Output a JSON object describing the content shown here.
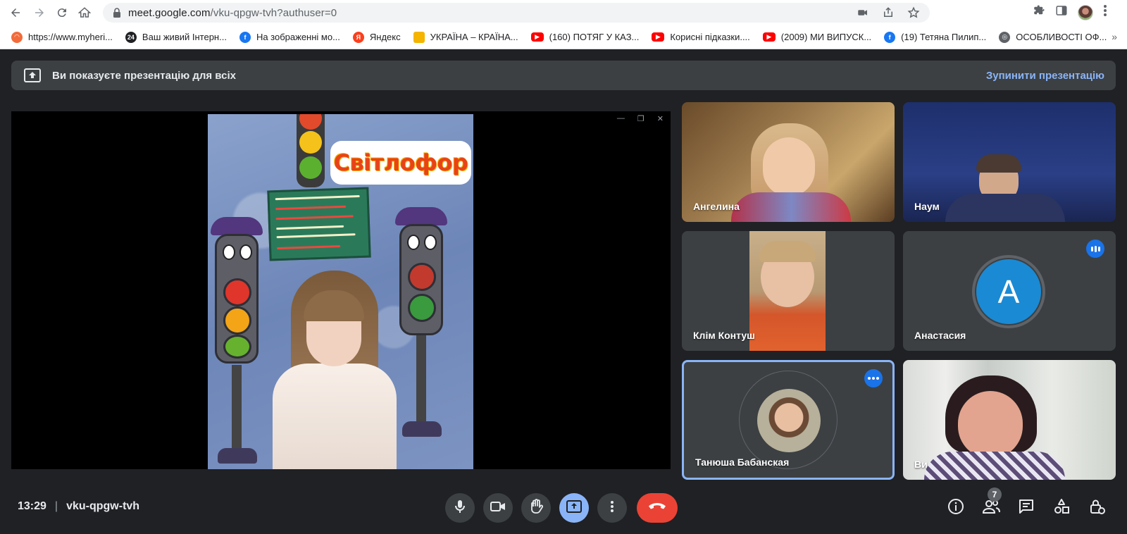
{
  "browser": {
    "url_host": "meet.google.com",
    "url_path": "/vku-qpgw-tvh?authuser=0",
    "bookmarks": [
      {
        "label": "https://www.myheri...",
        "color": "#f26b3a",
        "glyph": ""
      },
      {
        "label": "Ваш живий Інтерн...",
        "color": "#202124",
        "glyph": "24"
      },
      {
        "label": "На зображенні мо...",
        "color": "#1877f2",
        "glyph": "f"
      },
      {
        "label": "Яндекс",
        "color": "#fc3f1d",
        "glyph": "Я"
      },
      {
        "label": "УКРАЇНА – КРАЇНА...",
        "color": "#f4b400",
        "glyph": ""
      },
      {
        "label": "(160) ПОТЯГ У КАЗ...",
        "color": "#ff0000",
        "glyph": "▶",
        "yt": true
      },
      {
        "label": "Корисні підказки....",
        "color": "#ff0000",
        "glyph": "▶",
        "yt": true
      },
      {
        "label": "(2009) МИ ВИПУСК...",
        "color": "#ff0000",
        "glyph": "▶",
        "yt": true
      },
      {
        "label": "(19) Тетяна Пилип...",
        "color": "#1877f2",
        "glyph": "f"
      },
      {
        "label": "ОСОБЛИВОСТІ ОФ...",
        "color": "#5f6368",
        "glyph": "◎"
      }
    ],
    "bookmarks_more": "»"
  },
  "banner": {
    "message": "Ви показуєте презентацію для всіх",
    "stop_label": "Зупинити презентацію"
  },
  "presentation": {
    "slide_title": "Світлофор"
  },
  "participants": [
    {
      "name": "Ангелина"
    },
    {
      "name": "Наум"
    },
    {
      "name": "Клім Контуш"
    },
    {
      "name": "Анастасия",
      "initial": "A",
      "avatar_color": "#1a8ad4"
    },
    {
      "name": "Танюша Бабанская"
    },
    {
      "name": "Ви"
    }
  ],
  "meeting": {
    "time": "13:29",
    "separator": "|",
    "code": "vku-qpgw-tvh",
    "participant_count": "7"
  },
  "colors": {
    "accent": "#8ab4f8",
    "end_call": "#ea4335",
    "dark_bg": "#202124"
  }
}
